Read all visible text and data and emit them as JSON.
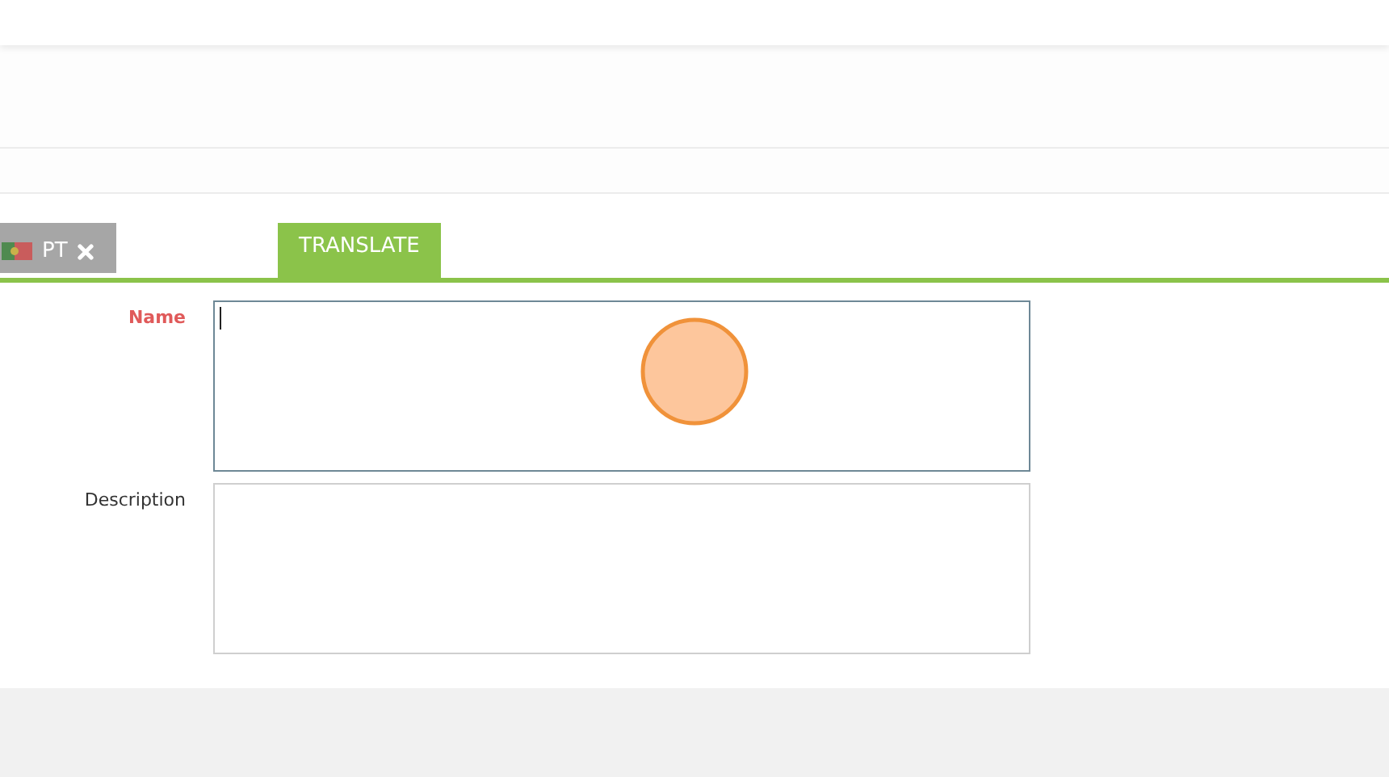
{
  "tabs": [
    {
      "kind": "language",
      "label": "PT"
    },
    {
      "kind": "action",
      "label": "TRANSLATE"
    }
  ],
  "fields": [
    {
      "label": "Name",
      "required": true,
      "focused": true
    },
    {
      "label": "Description",
      "required": false,
      "focused": false
    }
  ]
}
